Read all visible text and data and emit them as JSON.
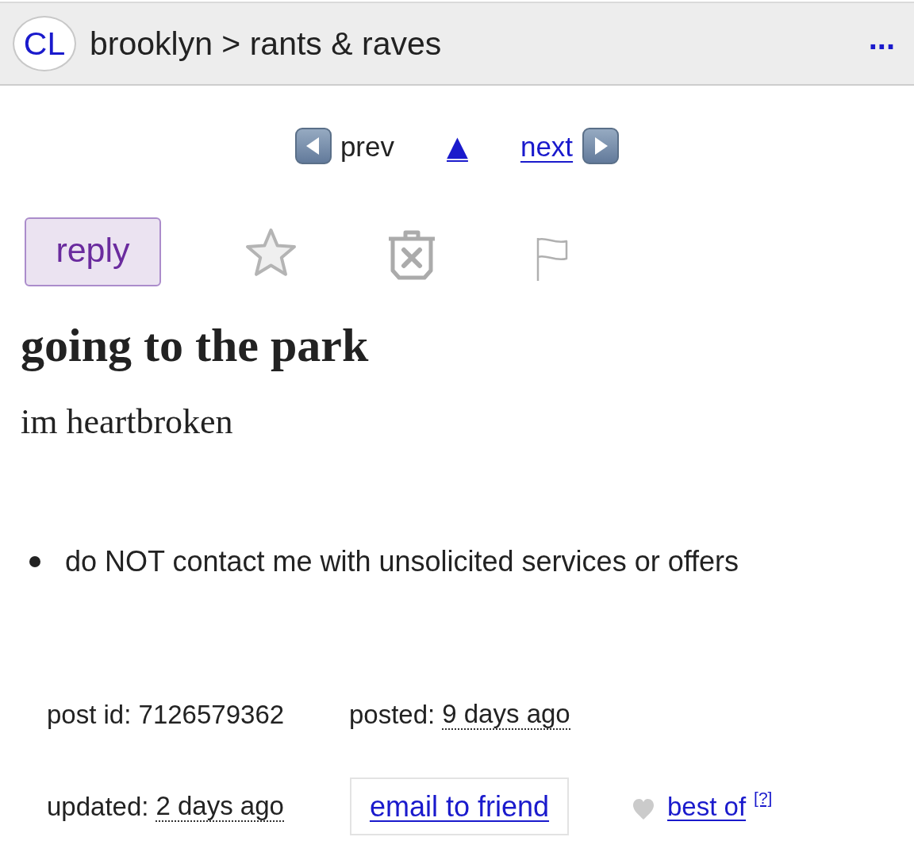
{
  "header": {
    "logo": "CL",
    "breadcrumb": "brooklyn > rants & raves",
    "menu": "..."
  },
  "nav": [
    {
      "kind": "prev",
      "label": "prev",
      "enabled": false
    },
    {
      "kind": "up",
      "label": "▲",
      "enabled": true
    },
    {
      "kind": "next",
      "label": "next",
      "enabled": true
    }
  ],
  "actions": {
    "reply": "reply"
  },
  "post": {
    "title": "going to the park",
    "body": "im heartbroken",
    "notices": [
      "do NOT contact me with unsolicited services or offers"
    ]
  },
  "meta": {
    "post_id": "post id: 7126579362",
    "posted": {
      "label": "posted:",
      "time": "9 days ago"
    },
    "updated": {
      "label": "updated:",
      "time": "2 days ago"
    }
  },
  "footer": {
    "email": "email to friend",
    "best_of": "best of",
    "help": "[?]"
  }
}
